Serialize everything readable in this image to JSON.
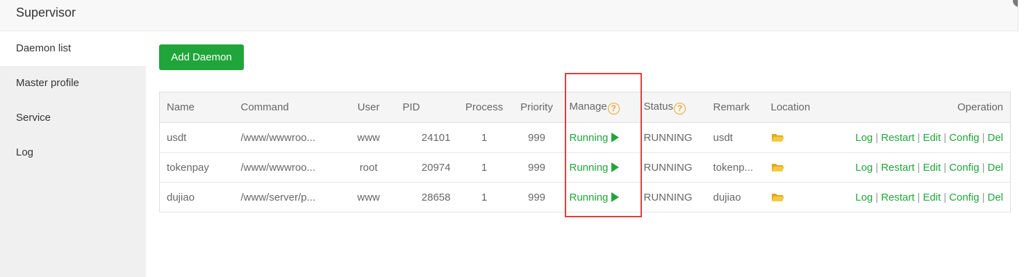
{
  "window": {
    "title": "Supervisor"
  },
  "sidebar": {
    "items": [
      {
        "label": "Daemon list",
        "active": true
      },
      {
        "label": "Master profile",
        "active": false
      },
      {
        "label": "Service",
        "active": false
      },
      {
        "label": "Log",
        "active": false
      }
    ]
  },
  "toolbar": {
    "add_label": "Add Daemon"
  },
  "table": {
    "headers": {
      "name": "Name",
      "command": "Command",
      "user": "User",
      "pid": "PID",
      "process": "Process",
      "priority": "Priority",
      "manage": "Manage",
      "status": "Status",
      "remark": "Remark",
      "location": "Location",
      "operation": "Operation"
    },
    "help_glyph": "?",
    "rows": [
      {
        "name": "usdt",
        "command": "/www/wwwroo...",
        "user": "www",
        "pid": "24101",
        "process": "1",
        "priority": "999",
        "manage": "Running",
        "status": "RUNNING",
        "remark": "usdt"
      },
      {
        "name": "tokenpay",
        "command": "/www/wwwroo...",
        "user": "root",
        "pid": "20974",
        "process": "1",
        "priority": "999",
        "manage": "Running",
        "status": "RUNNING",
        "remark": "tokenp..."
      },
      {
        "name": "dujiao",
        "command": "/www/server/p...",
        "user": "www",
        "pid": "28658",
        "process": "1",
        "priority": "999",
        "manage": "Running",
        "status": "RUNNING",
        "remark": "dujiao"
      }
    ],
    "operations": {
      "log": "Log",
      "restart": "Restart",
      "edit": "Edit",
      "config": "Config",
      "del": "Del",
      "separator": "|"
    }
  },
  "colors": {
    "accent_green": "#20a53a",
    "help_orange": "#f0a229",
    "highlight_red": "#e03a3a",
    "folder_yellow": "#f5c842"
  },
  "icons": {
    "manage_action": "play-icon",
    "location": "folder-icon",
    "header_help": "help-icon"
  }
}
